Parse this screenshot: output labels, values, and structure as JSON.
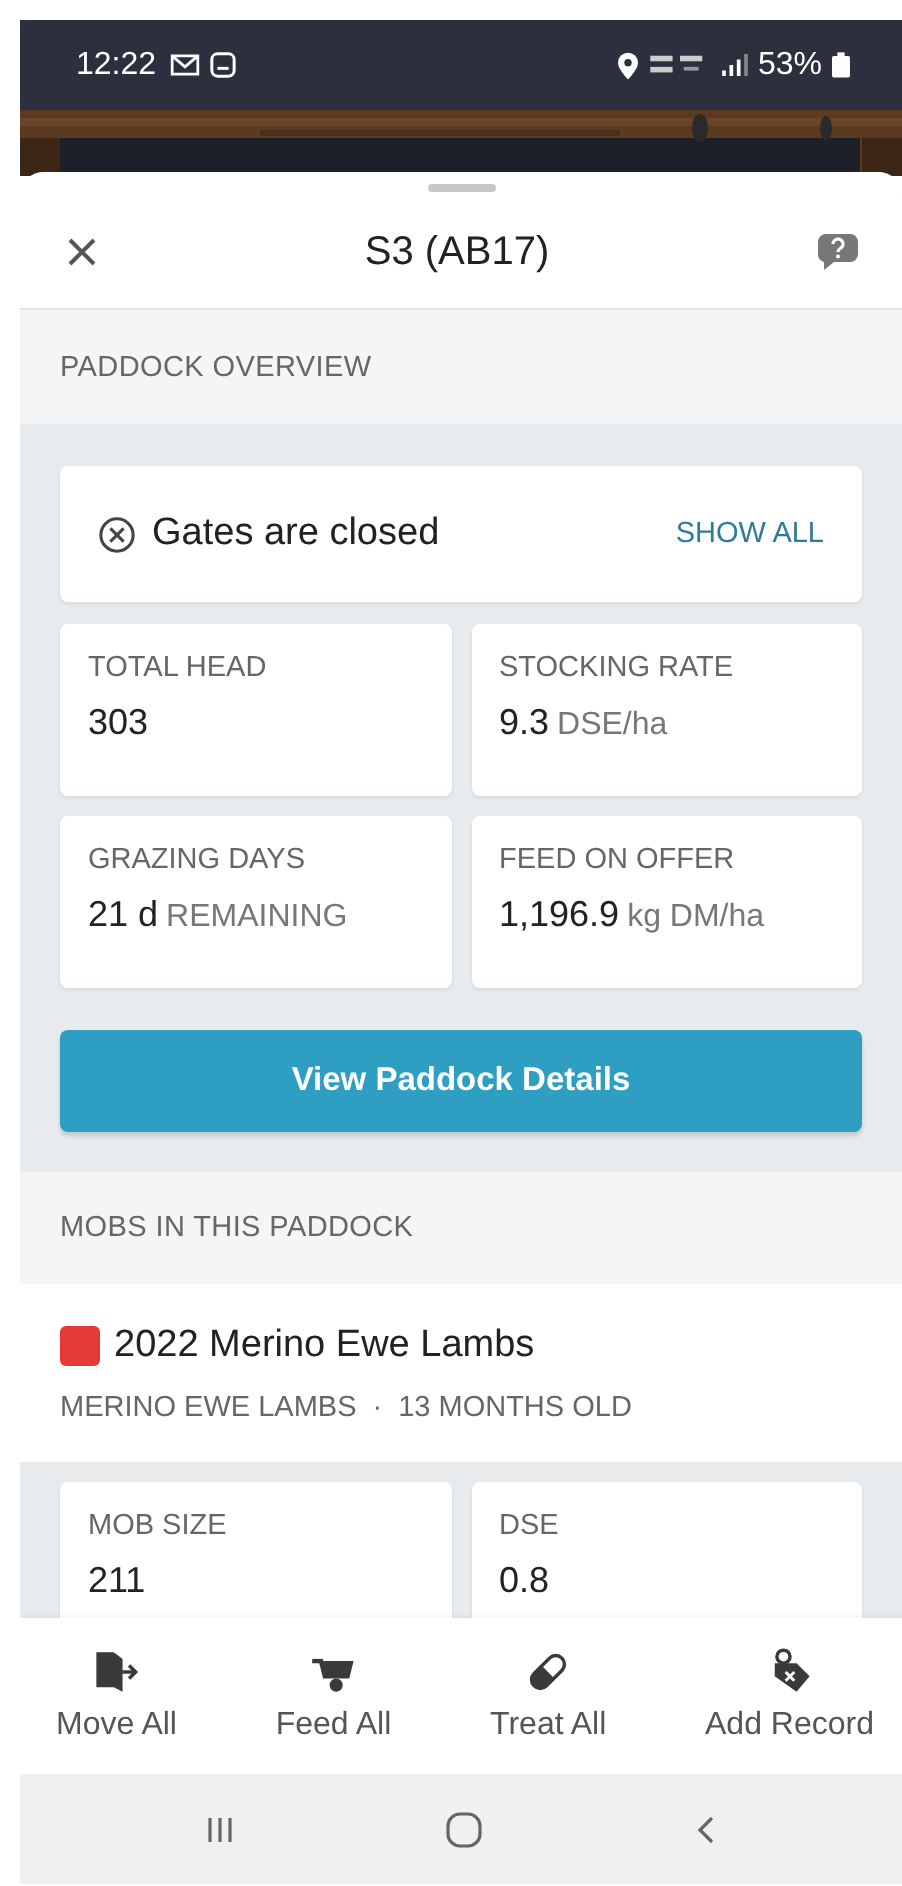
{
  "status_bar": {
    "time": "12:22",
    "battery": "53%"
  },
  "sheet": {
    "title": "S3 (AB17)"
  },
  "overview": {
    "heading": "PADDOCK OVERVIEW",
    "gates": {
      "text": "Gates are closed",
      "action": "SHOW ALL"
    },
    "stats": [
      {
        "label": "TOTAL HEAD",
        "value": "303"
      },
      {
        "label": "STOCKING RATE",
        "value": "9.3",
        "unit": "DSE/ha"
      },
      {
        "label": "GRAZING DAYS",
        "value": "21 d",
        "unit": "REMAINING"
      },
      {
        "label": "FEED ON OFFER",
        "value": "1,196.9",
        "unit": "kg DM/ha"
      }
    ],
    "button": "View Paddock Details"
  },
  "mobs": {
    "heading": "MOBS IN THIS PADDOCK",
    "items": [
      {
        "name": "2022 Merino Ewe Lambs",
        "color": "#e53935",
        "breed": "MERINO EWE LAMBS",
        "separator": "·",
        "age": "13 MONTHS OLD",
        "stats": [
          {
            "label": "MOB SIZE",
            "value": "211"
          },
          {
            "label": "DSE",
            "value": "0.8"
          }
        ]
      }
    ]
  },
  "actions": [
    {
      "kind": "move",
      "label": "Move All"
    },
    {
      "kind": "feed",
      "label": "Feed All"
    },
    {
      "kind": "treat",
      "label": "Treat All"
    },
    {
      "kind": "record",
      "label": "Add Record"
    }
  ]
}
